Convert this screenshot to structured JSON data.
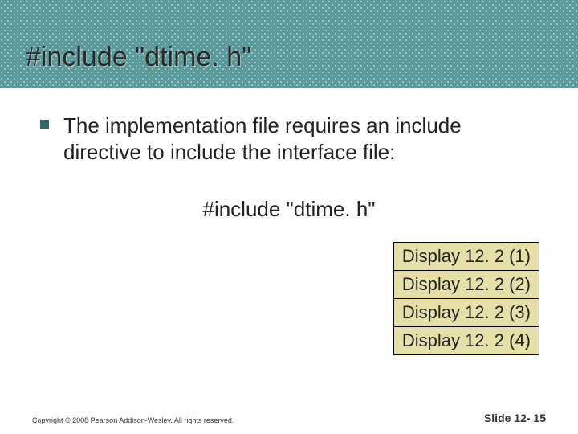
{
  "title": "#include \"dtime. h\"",
  "body": {
    "bullet_text": "The implementation file requires an include directive to include the interface file:",
    "inline_code": "#include \"dtime. h\""
  },
  "links": [
    "Display 12. 2 (1)",
    "Display 12. 2 (2)",
    "Display 12. 2 (3)",
    "Display 12. 2 (4)"
  ],
  "footer": {
    "copyright": "Copyright © 2008 Pearson Addison-Wesley. All rights reserved.",
    "slidenum": "Slide 12- 15"
  }
}
